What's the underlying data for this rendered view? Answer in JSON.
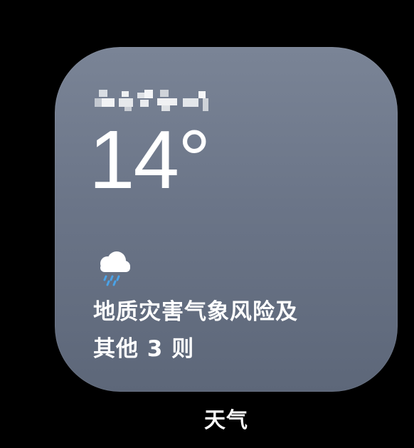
{
  "widget": {
    "location": "",
    "location_obscured": true,
    "temperature": "14°",
    "condition_icon": "cloud-rain-icon",
    "alert_line1": "地质灾害气象风险及",
    "alert_line2": "其他 3 则"
  },
  "app": {
    "label": "天气"
  },
  "colors": {
    "background": "#000000",
    "widget_top": "#7a8496",
    "widget_bottom": "#5d6779",
    "text": "#ffffff",
    "rain": "#4aa3e8"
  }
}
